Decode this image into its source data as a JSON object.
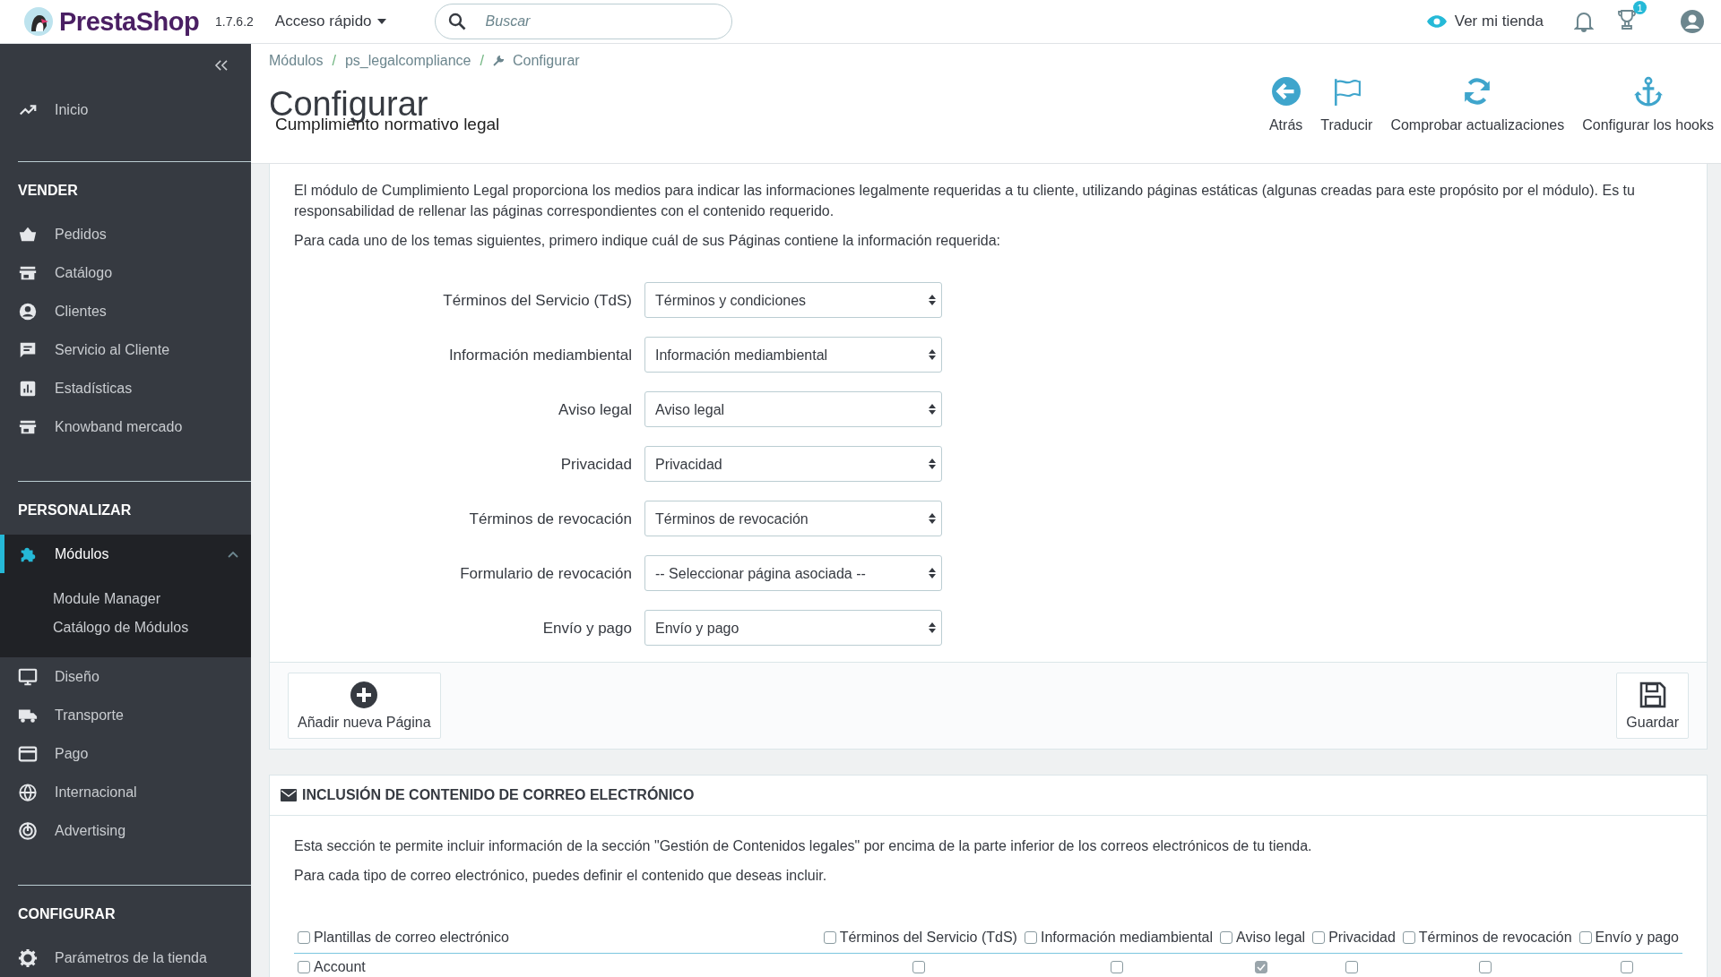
{
  "topbar": {
    "logo": "PrestaShop",
    "version": "1.7.6.2",
    "quick_access": "Acceso rápido",
    "search": {
      "placeholder": "Buscar"
    },
    "view_store": "Ver mi tienda",
    "notification_badge": "1"
  },
  "sidebar": {
    "top_item": {
      "label": "Inicio",
      "selected": false
    },
    "sections": [
      {
        "title": "VENDER",
        "items": [
          {
            "label": "Pedidos",
            "selected": false
          },
          {
            "label": "Catálogo",
            "selected": false
          },
          {
            "label": "Clientes",
            "selected": false
          },
          {
            "label": "Servicio al Cliente",
            "selected": false
          },
          {
            "label": "Estadísticas",
            "selected": false
          },
          {
            "label": "Knowband mercado",
            "selected": false
          }
        ]
      },
      {
        "title": "PERSONALIZAR",
        "items": [
          {
            "label": "Módulos",
            "selected": true,
            "expanded": true,
            "children": [
              {
                "label": "Module Manager",
                "selected": false
              },
              {
                "label": "Catálogo de Módulos",
                "selected": false
              }
            ]
          },
          {
            "label": "Diseño",
            "selected": false
          },
          {
            "label": "Transporte",
            "selected": false
          },
          {
            "label": "Pago",
            "selected": false
          },
          {
            "label": "Internacional",
            "selected": false
          },
          {
            "label": "Advertising",
            "selected": false
          }
        ]
      },
      {
        "title": "CONFIGURAR",
        "items": [
          {
            "label": "Parámetros de la tienda",
            "selected": false
          }
        ]
      }
    ]
  },
  "page_header": {
    "breadcrumb": [
      "Módulos",
      "ps_legalcompliance",
      "Configurar"
    ],
    "breadcrumb_separators": [
      "/",
      "/"
    ],
    "title": "Configurar",
    "subtitle": "Cumplimiento normativo legal",
    "toolbar": [
      {
        "label": "Atrás"
      },
      {
        "label": "Traducir"
      },
      {
        "label": "Comprobar actualizaciones"
      },
      {
        "label": "Configurar los hooks"
      }
    ]
  },
  "legal_panel": {
    "paragraphs": [
      "El módulo de Cumplimiento Legal proporciona los medios para indicar las informaciones legalmente requeridas a tu cliente, utilizando páginas estáticas (algunas creadas para este propósito por el módulo). Es tu responsabilidad de rellenar las páginas correspondientes con el contenido requerido.",
      "Para cada uno de los temas siguientes, primero indique cuál de sus Páginas contiene la información requerida:"
    ],
    "fields": [
      {
        "label": "Términos del Servicio (TdS)",
        "value": "Términos y condiciones"
      },
      {
        "label": "Información mediambiental",
        "value": "Información mediambiental"
      },
      {
        "label": "Aviso legal",
        "value": "Aviso legal"
      },
      {
        "label": "Privacidad",
        "value": "Privacidad"
      },
      {
        "label": "Términos de revocación",
        "value": "Términos de revocación"
      },
      {
        "label": "Formulario de revocación",
        "value": "-- Seleccionar página asociada --"
      },
      {
        "label": "Envío y pago",
        "value": "Envío y pago"
      }
    ],
    "add_button": "Añadir nueva Página",
    "save_button": "Guardar"
  },
  "email_panel": {
    "title": "INCLUSIÓN DE CONTENIDO DE CORREO ELECTRÓNICO",
    "paragraphs": [
      "Esta sección te permite incluir información de la sección \"Gestión de Contenidos legales\" por encima de la parte inferior de los correos electrónicos de tu tienda.",
      "Para cada tipo de correo electrónico, puedes definir el contenido que deseas incluir."
    ],
    "columns": [
      {
        "label": "Plantillas de correo electrónico",
        "checked": false
      },
      {
        "label": "Términos del Servicio (TdS)",
        "checked": false
      },
      {
        "label": "Información mediambiental",
        "checked": false
      },
      {
        "label": "Aviso legal",
        "checked": false
      },
      {
        "label": "Privacidad",
        "checked": false
      },
      {
        "label": "Términos de revocación",
        "checked": false
      },
      {
        "label": "Envío y pago",
        "checked": false
      }
    ],
    "rows": [
      {
        "label": "Account",
        "checked": false,
        "cells": [
          {
            "checked": false
          },
          {
            "checked": false
          },
          {
            "checked": true
          },
          {
            "checked": false
          },
          {
            "checked": false
          },
          {
            "checked": false
          }
        ]
      }
    ]
  }
}
